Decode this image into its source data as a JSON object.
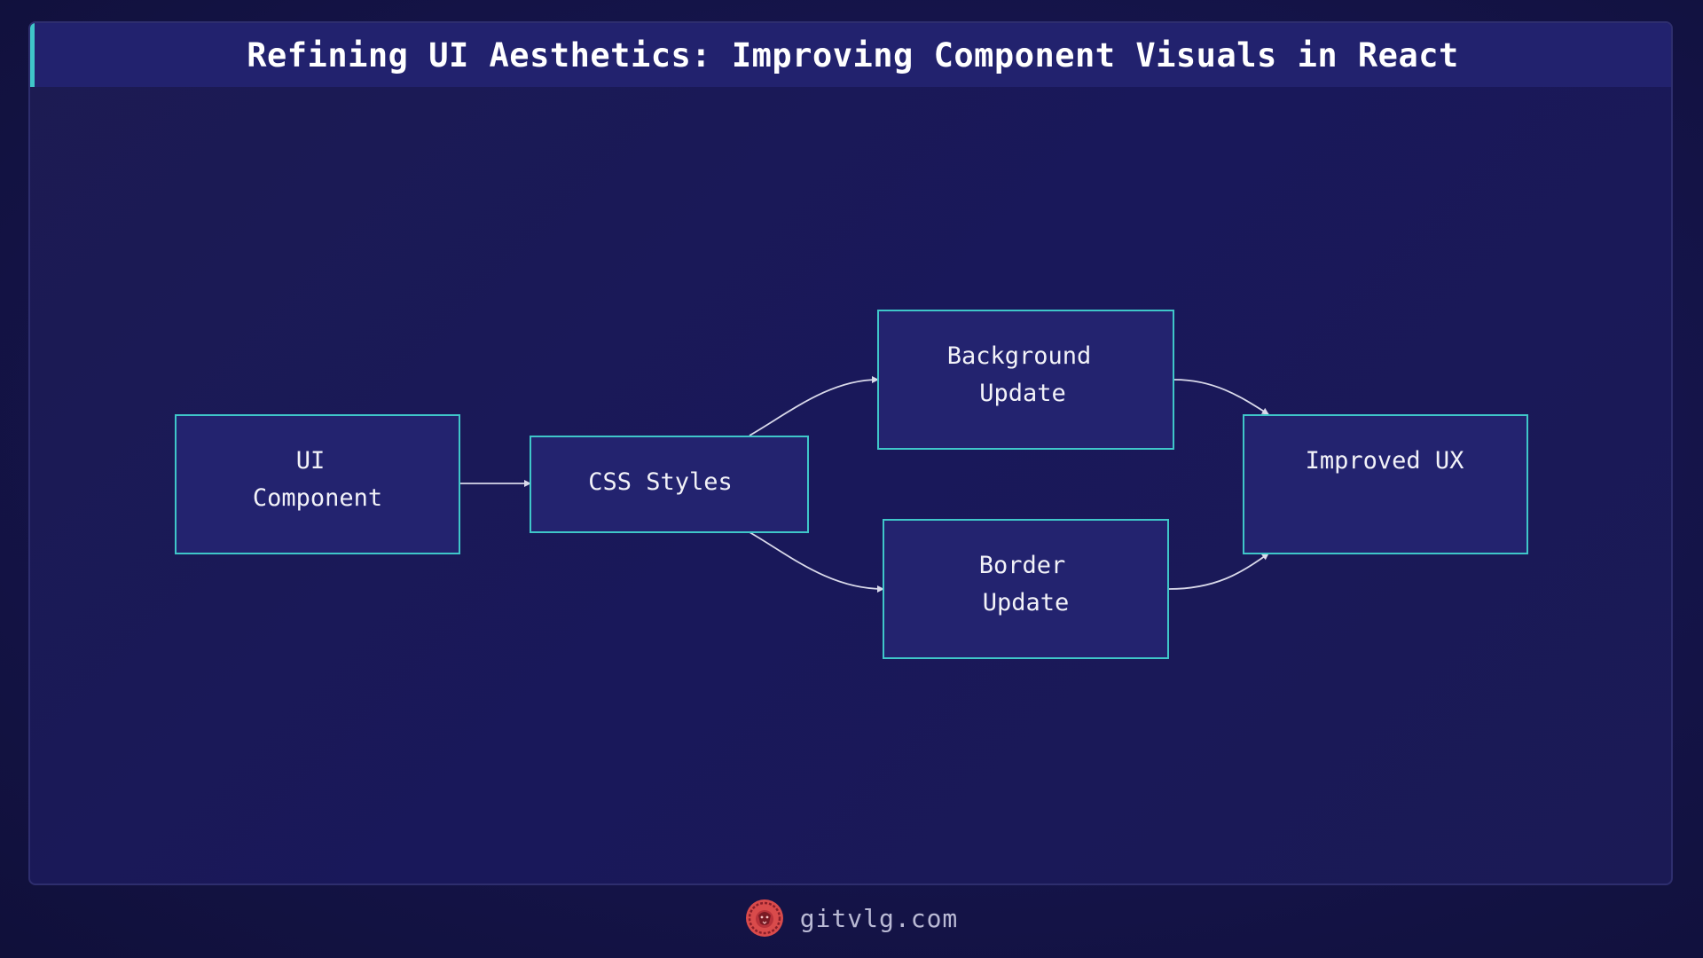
{
  "title": "Refining UI Aesthetics: Improving Component Visuals in React",
  "nodes": {
    "ui_component": {
      "line1": "UI",
      "line2": "Component"
    },
    "css_styles": {
      "line1": "CSS Styles"
    },
    "background_update": {
      "line1": "Background",
      "line2": "Update"
    },
    "border_update": {
      "line1": "Border",
      "line2": "Update"
    },
    "improved_ux": {
      "line1": "Improved UX"
    }
  },
  "edges": [
    {
      "from": "UI Component",
      "to": "CSS Styles"
    },
    {
      "from": "CSS Styles",
      "to": "Background Update"
    },
    {
      "from": "CSS Styles",
      "to": "Border Update"
    },
    {
      "from": "Background Update",
      "to": "Improved UX"
    },
    {
      "from": "Border Update",
      "to": "Improved UX"
    }
  ],
  "footer": {
    "site": "gitvlg.com",
    "logo_icon": "lion-logo-icon"
  },
  "colors": {
    "background": "#15144a",
    "node_fill": "#23236f",
    "node_border": "#3fc6c9",
    "title_accent": "#3fc6c9",
    "edge": "#d9d9ea",
    "logo": "#d94b4b"
  }
}
